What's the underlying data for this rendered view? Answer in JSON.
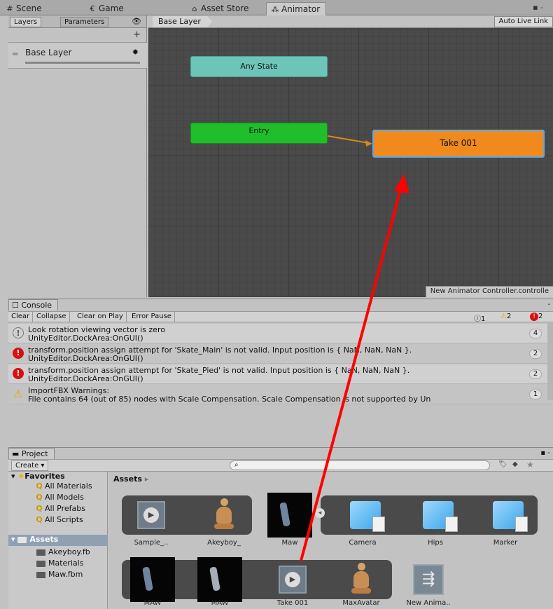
{
  "top_tabs": {
    "scene": "Scene",
    "game": "Game",
    "asset_store": "Asset Store",
    "animator": "Animator"
  },
  "animator": {
    "tabs": [
      "Layers",
      "Parameters"
    ],
    "add_symbol": "+",
    "layer_name": "Base Layer",
    "breadcrumb": "Base Layer",
    "auto_live_link": "Auto Live Link",
    "nodes": {
      "any_state": "Any State",
      "entry": "Entry",
      "take": "Take 001"
    },
    "controller_name": "New Animator Controller.controlle",
    "colors": {
      "any_state": "#6cc5b8",
      "entry": "#1fbe2a",
      "take": "#f08a1c",
      "transition": "#d08a22",
      "annotation_arrow": "#ff0000"
    }
  },
  "console": {
    "title": "Console",
    "buttons": [
      "Clear",
      "Collapse",
      "Clear on Play",
      "Error Pause"
    ],
    "counts": {
      "info": "1",
      "warning": "2",
      "error": "2"
    },
    "messages": [
      {
        "type": "info",
        "line1": "Look rotation viewing vector is zero",
        "line2": "UnityEditor.DockArea:OnGUI()",
        "count": "4"
      },
      {
        "type": "error",
        "line1": "transform.position assign attempt for 'Skate_Main' is not valid. Input position is { NaN, NaN, NaN }.",
        "line2": "UnityEditor.DockArea:OnGUI()",
        "count": "2"
      },
      {
        "type": "error",
        "line1": "transform.position assign attempt for 'Skate_Pied' is not valid. Input position is { NaN, NaN, NaN }.",
        "line2": "UnityEditor.DockArea:OnGUI()",
        "count": "2"
      },
      {
        "type": "warning",
        "line1": "ImportFBX Warnings:",
        "line2": "File contains 64 (out of 85) nodes with Scale Compensation. Scale Compensation is not supported by Un",
        "count": "1"
      }
    ]
  },
  "project": {
    "title": "Project",
    "create": "Create",
    "search_placeholder": "",
    "favorites_label": "Favorites",
    "favorites": [
      "All Materials",
      "All Models",
      "All Prefabs",
      "All Scripts"
    ],
    "assets_label": "Assets",
    "asset_folders": [
      "Akeyboy.fb",
      "Materials",
      "Maw.fbm"
    ],
    "breadcrumb": "Assets",
    "row1": [
      "Sample_..",
      "Akeyboy_",
      "Maw",
      "Camera",
      "Hips",
      "Marker"
    ],
    "row2": [
      "MAW",
      "MAW",
      "Take 001",
      "MaxAvatar",
      "New Anima.."
    ]
  }
}
